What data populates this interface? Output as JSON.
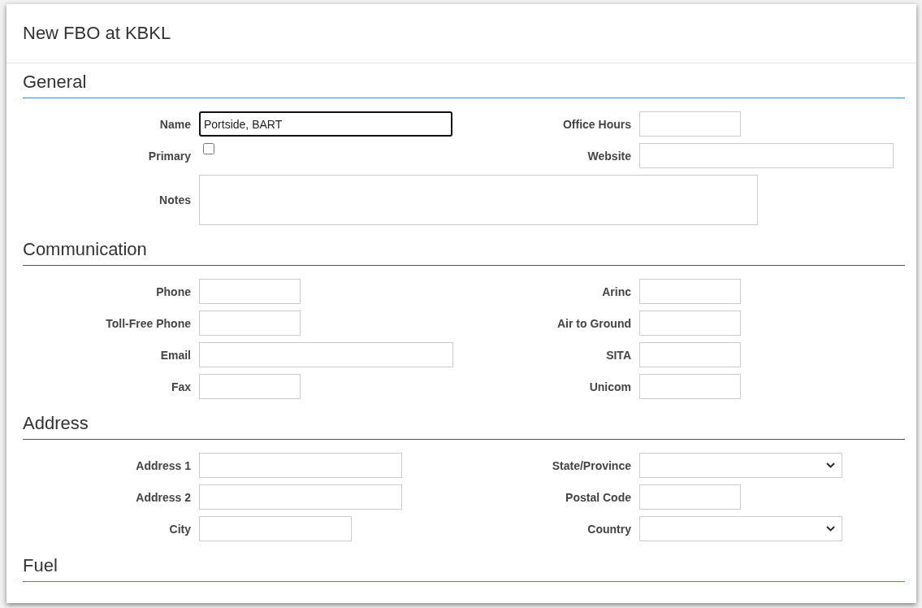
{
  "dialog": {
    "title": "New FBO at KBKL"
  },
  "sections": [
    {
      "title": "General",
      "color": "#1e88e5",
      "rows": [
        {
          "left": {
            "kind": "text",
            "label": "Name",
            "value": "Portside, BART",
            "focused": true
          },
          "right": {
            "kind": "text",
            "label": "Office Hours",
            "focused": false
          }
        },
        {
          "left": {
            "kind": "checkbox",
            "label": "Primary",
            "checked": false
          },
          "right": {
            "kind": "text",
            "label": "Website",
            "focused": false
          }
        },
        {
          "wide": {
            "kind": "textarea",
            "label": "Notes"
          }
        }
      ]
    },
    {
      "title": "Communication",
      "color": "#555555",
      "rows": [
        {
          "left": {
            "kind": "text",
            "label": "Phone",
            "focused": false
          },
          "right": {
            "kind": "text",
            "label": "Arinc",
            "focused": false
          }
        },
        {
          "left": {
            "kind": "text",
            "label": "Toll-Free Phone",
            "focused": false
          },
          "right": {
            "kind": "text",
            "label": "Air to Ground",
            "focused": false
          }
        },
        {
          "left": {
            "kind": "text",
            "label": "Email",
            "focused": false
          },
          "right": {
            "kind": "text",
            "label": "SITA",
            "focused": false
          }
        },
        {
          "left": {
            "kind": "text",
            "label": "Fax",
            "focused": false
          },
          "right": {
            "kind": "text",
            "label": "Unicom",
            "focused": false
          }
        }
      ]
    },
    {
      "title": "Address",
      "color": "#555555",
      "rows": [
        {
          "left": {
            "kind": "text",
            "label": "Address 1",
            "focused": false
          },
          "right": {
            "kind": "select",
            "label": "State/Province"
          }
        },
        {
          "left": {
            "kind": "text",
            "label": "Address 2",
            "focused": false
          },
          "right": {
            "kind": "text",
            "label": "Postal Code",
            "focused": false
          }
        },
        {
          "left": {
            "kind": "text",
            "label": "City",
            "focused": false
          },
          "right": {
            "kind": "select",
            "label": "Country"
          }
        }
      ]
    },
    {
      "title": "Fuel",
      "color": "#1e88e5"
    }
  ]
}
